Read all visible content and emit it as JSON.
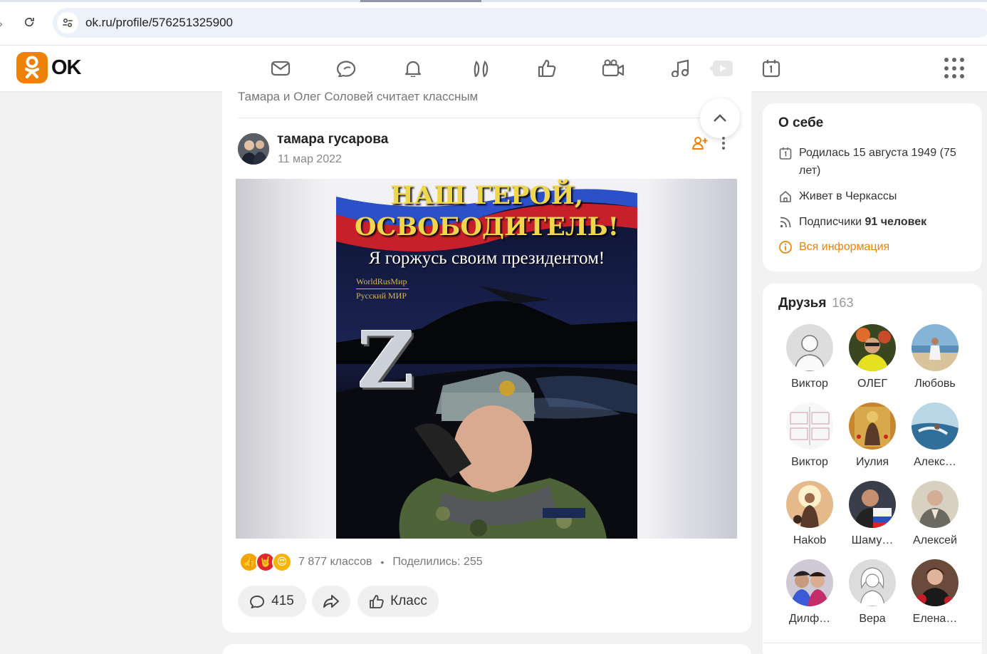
{
  "browser": {
    "url": "ok.ru/profile/576251325900"
  },
  "header": {
    "logo_text": "OK",
    "nav": [
      {
        "name": "messages-icon"
      },
      {
        "name": "discussions-icon"
      },
      {
        "name": "notifications-icon"
      },
      {
        "name": "guests-icon"
      },
      {
        "name": "likes-icon"
      },
      {
        "name": "video-icon"
      },
      {
        "name": "music-icon"
      },
      {
        "name": "video-play-icon"
      },
      {
        "name": "calendar-icon"
      }
    ],
    "accent_color": "#ee8208"
  },
  "feed": {
    "liked_by": "Тамара и Олег Соловей считает классным",
    "post": {
      "author": "тамара гусарова",
      "date": "11 мар 2022",
      "image": {
        "title_line1": "НАШ ГЕРОЙ,",
        "title_line2": "ОСВОБОДИТЕЛЬ!",
        "subtitle": "Я горжусь своим президентом!",
        "watermark_line1": "WorldRusМир",
        "watermark_line2": "Русский МИР",
        "letter": "Z"
      },
      "reactions_count": "7 877 классов",
      "shares": "Поделились: 255",
      "comments_count": "415",
      "class_label": "Класс"
    }
  },
  "about": {
    "title": "О себе",
    "born": "Родилась 15 августа 1949 (75",
    "born_cont": "лет)",
    "lives": "Живет в Черкассы",
    "followers_label": "Подписчики",
    "followers_value": "91 человек",
    "all_info": "Вся информация"
  },
  "friends": {
    "title": "Друзья",
    "count": "163",
    "items": [
      {
        "name": "Виктор"
      },
      {
        "name": "ОЛЕГ"
      },
      {
        "name": "Любовь"
      },
      {
        "name": "Виктор"
      },
      {
        "name": "Иулия"
      },
      {
        "name": "Алекс…"
      },
      {
        "name": "Hakob"
      },
      {
        "name": "Шаму…"
      },
      {
        "name": "Алексей"
      },
      {
        "name": "Дилф…"
      },
      {
        "name": "Вера"
      },
      {
        "name": "Елена…"
      }
    ]
  }
}
